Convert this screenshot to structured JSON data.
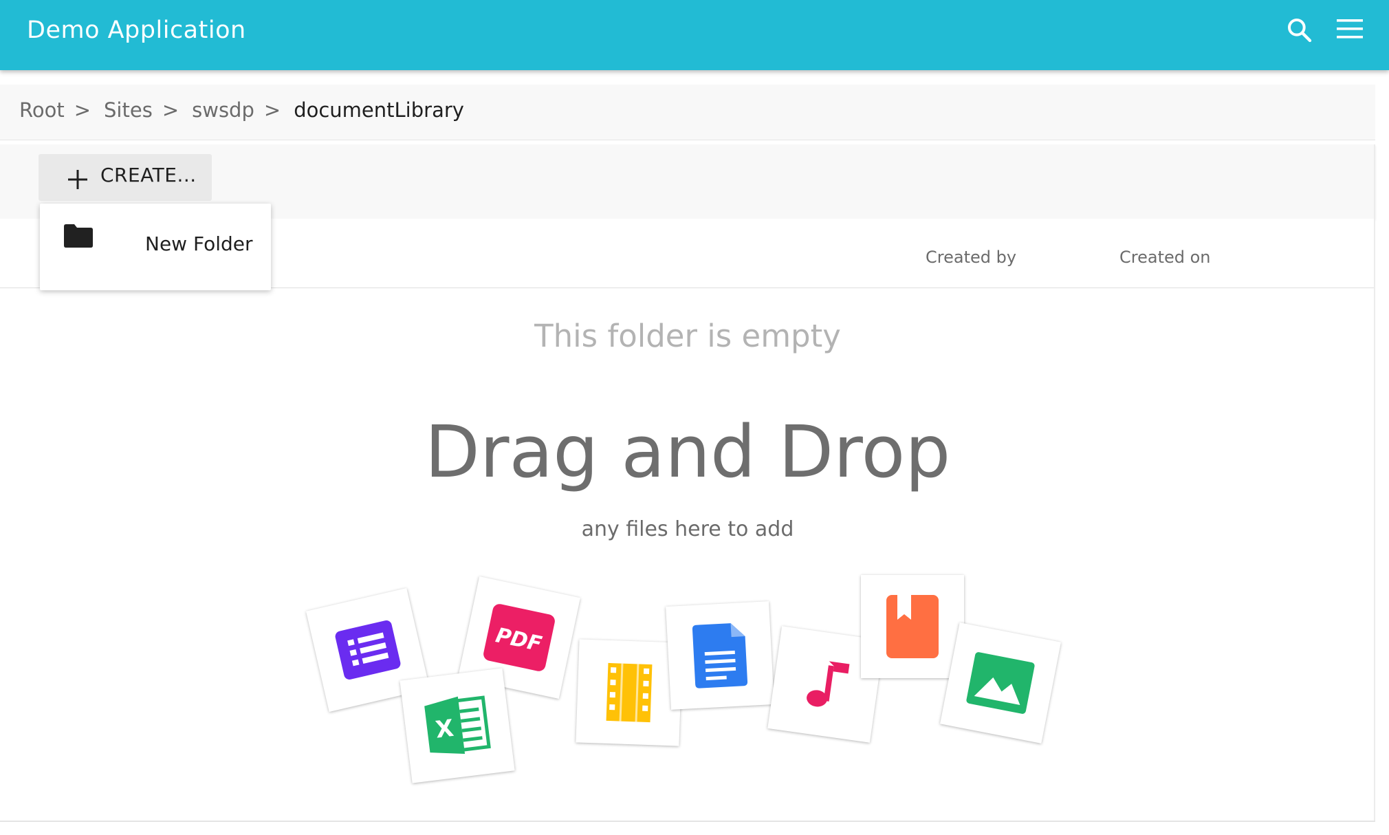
{
  "app": {
    "title": "Demo Application",
    "colors": {
      "primary": "#22bbd4",
      "surface": "#f8f8f8"
    },
    "icons": {
      "search": "search-icon",
      "menu": "menu-icon"
    }
  },
  "breadcrumb": {
    "items": [
      {
        "label": "Root"
      },
      {
        "label": "Sites"
      },
      {
        "label": "swsdp"
      },
      {
        "label": "documentLibrary"
      }
    ],
    "separator": ">"
  },
  "toolbar": {
    "create_label": "CREATE...",
    "create_icon": "plus-icon"
  },
  "create_menu": {
    "items": [
      {
        "label": "New Folder",
        "icon": "folder-icon"
      }
    ]
  },
  "table": {
    "columns": [
      {
        "label": "Created by"
      },
      {
        "label": "Created on"
      }
    ]
  },
  "empty_state": {
    "title": "This folder is empty",
    "drag_title": "Drag and Drop",
    "drag_subtitle": "any files here to add",
    "file_type_icons": [
      {
        "name": "form-icon",
        "color": "#6a2cf0"
      },
      {
        "name": "pdf-icon",
        "color": "#ec1f65",
        "text": "PDF"
      },
      {
        "name": "excel-icon",
        "color": "#21b56b",
        "text": "X"
      },
      {
        "name": "video-icon",
        "color": "#ffc107"
      },
      {
        "name": "document-icon",
        "color": "#2d7cf0"
      },
      {
        "name": "music-icon",
        "color": "#e91e63"
      },
      {
        "name": "bookmark-icon",
        "color": "#ff6f42"
      },
      {
        "name": "image-icon",
        "color": "#21b56b"
      }
    ]
  }
}
